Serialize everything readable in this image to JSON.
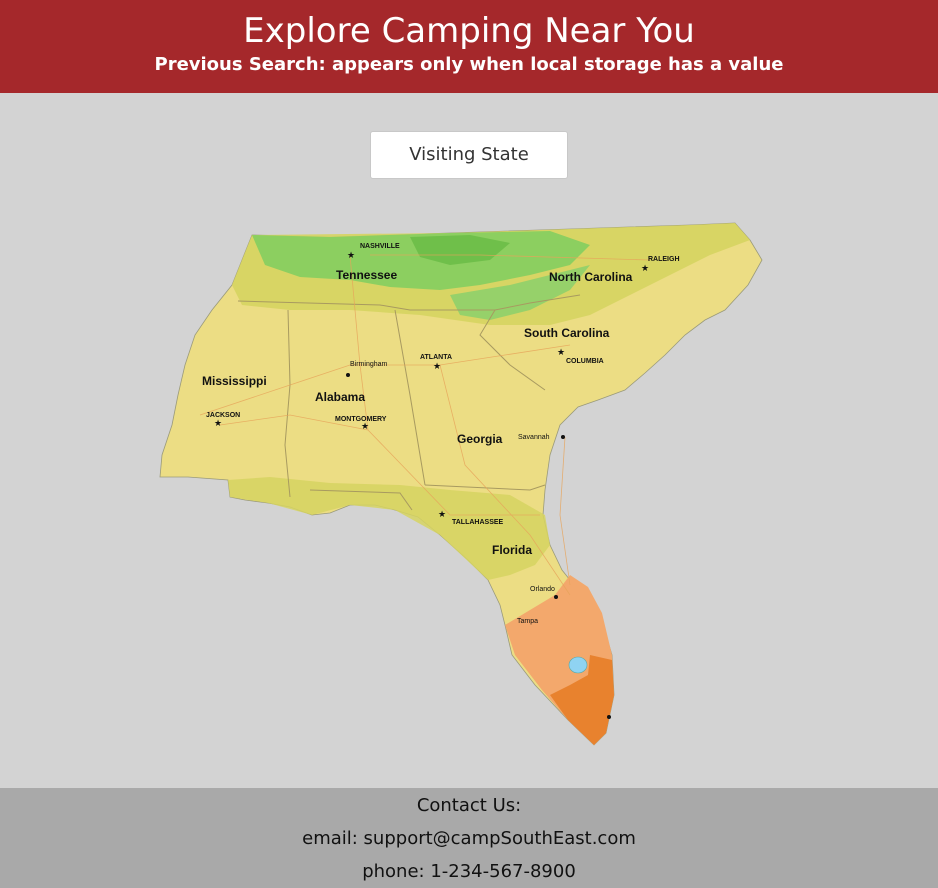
{
  "header": {
    "title": "Explore Camping Near You",
    "subtitle": "Previous Search: appears only when local storage has a value"
  },
  "search": {
    "button_label": "Visiting State"
  },
  "map": {
    "states": {
      "tennessee": "Tennessee",
      "north_carolina": "North Carolina",
      "south_carolina": "South Carolina",
      "mississippi": "Mississippi",
      "alabama": "Alabama",
      "georgia": "Georgia",
      "florida": "Florida"
    },
    "cities": {
      "nashville": "NASHVILLE",
      "raleigh": "RALEIGH",
      "birmingham": "Birmingham",
      "atlanta": "ATLANTA",
      "columbia": "COLUMBIA",
      "jackson": "JACKSON",
      "montgomery": "MONTGOMERY",
      "savannah": "Savannah",
      "tallahassee": "TALLAHASSEE",
      "orlando": "Orlando",
      "tampa": "Tampa"
    },
    "colors": {
      "green": "#8ccf60",
      "yellow_green": "#d6d460",
      "yellow": "#ecdd84",
      "orange_light": "#f3a86c",
      "orange": "#e8822e",
      "water": "#8fd3f2",
      "borders": "#a89a60"
    }
  },
  "footer": {
    "heading": "Contact Us:",
    "email": "email: support@campSouthEast.com",
    "phone": "phone: 1-234-567-8900"
  }
}
